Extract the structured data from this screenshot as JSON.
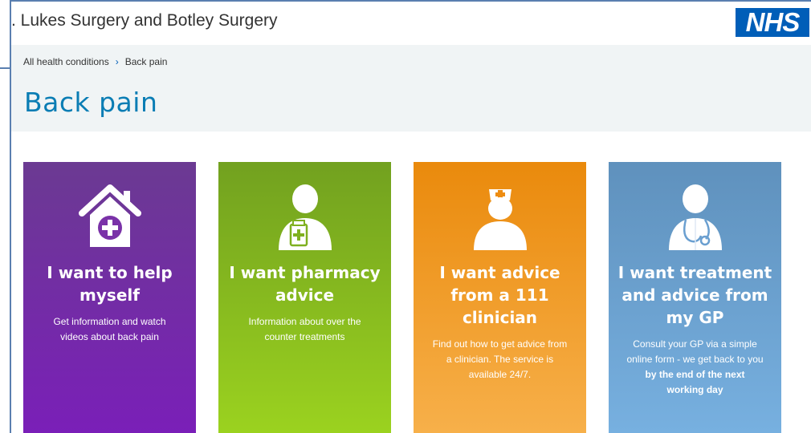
{
  "header": {
    "surgery_name": ". Lukes Surgery and Botley Surgery",
    "logo_text": "NHS",
    "logo_color": "#005eb8"
  },
  "breadcrumb": {
    "parent": "All health conditions",
    "separator": "›",
    "current": "Back pain"
  },
  "page": {
    "title": "Back pain",
    "title_color": "#0a7db4"
  },
  "cards": [
    {
      "title": "I want to help myself",
      "desc": "Get information and watch videos about back pain",
      "icon": "home-medical-icon",
      "color": "#7a1fb8"
    },
    {
      "title": "I want pharmacy advice",
      "desc": "Information about over the counter treatments",
      "icon": "pharmacist-icon",
      "color": "#8cc21f"
    },
    {
      "title": "I want advice from a 111 clinician",
      "desc": "Find out how to get advice from a clinician. The service is available 24/7.",
      "icon": "nurse-icon",
      "color": "#f29b1f"
    },
    {
      "title": "I want treatment and advice from my GP",
      "desc": "Consult your GP via a simple online form - we get back to you",
      "desc_bold": "by the end of the next working day",
      "icon": "doctor-stethoscope-icon",
      "color": "#6a9fd0"
    }
  ]
}
